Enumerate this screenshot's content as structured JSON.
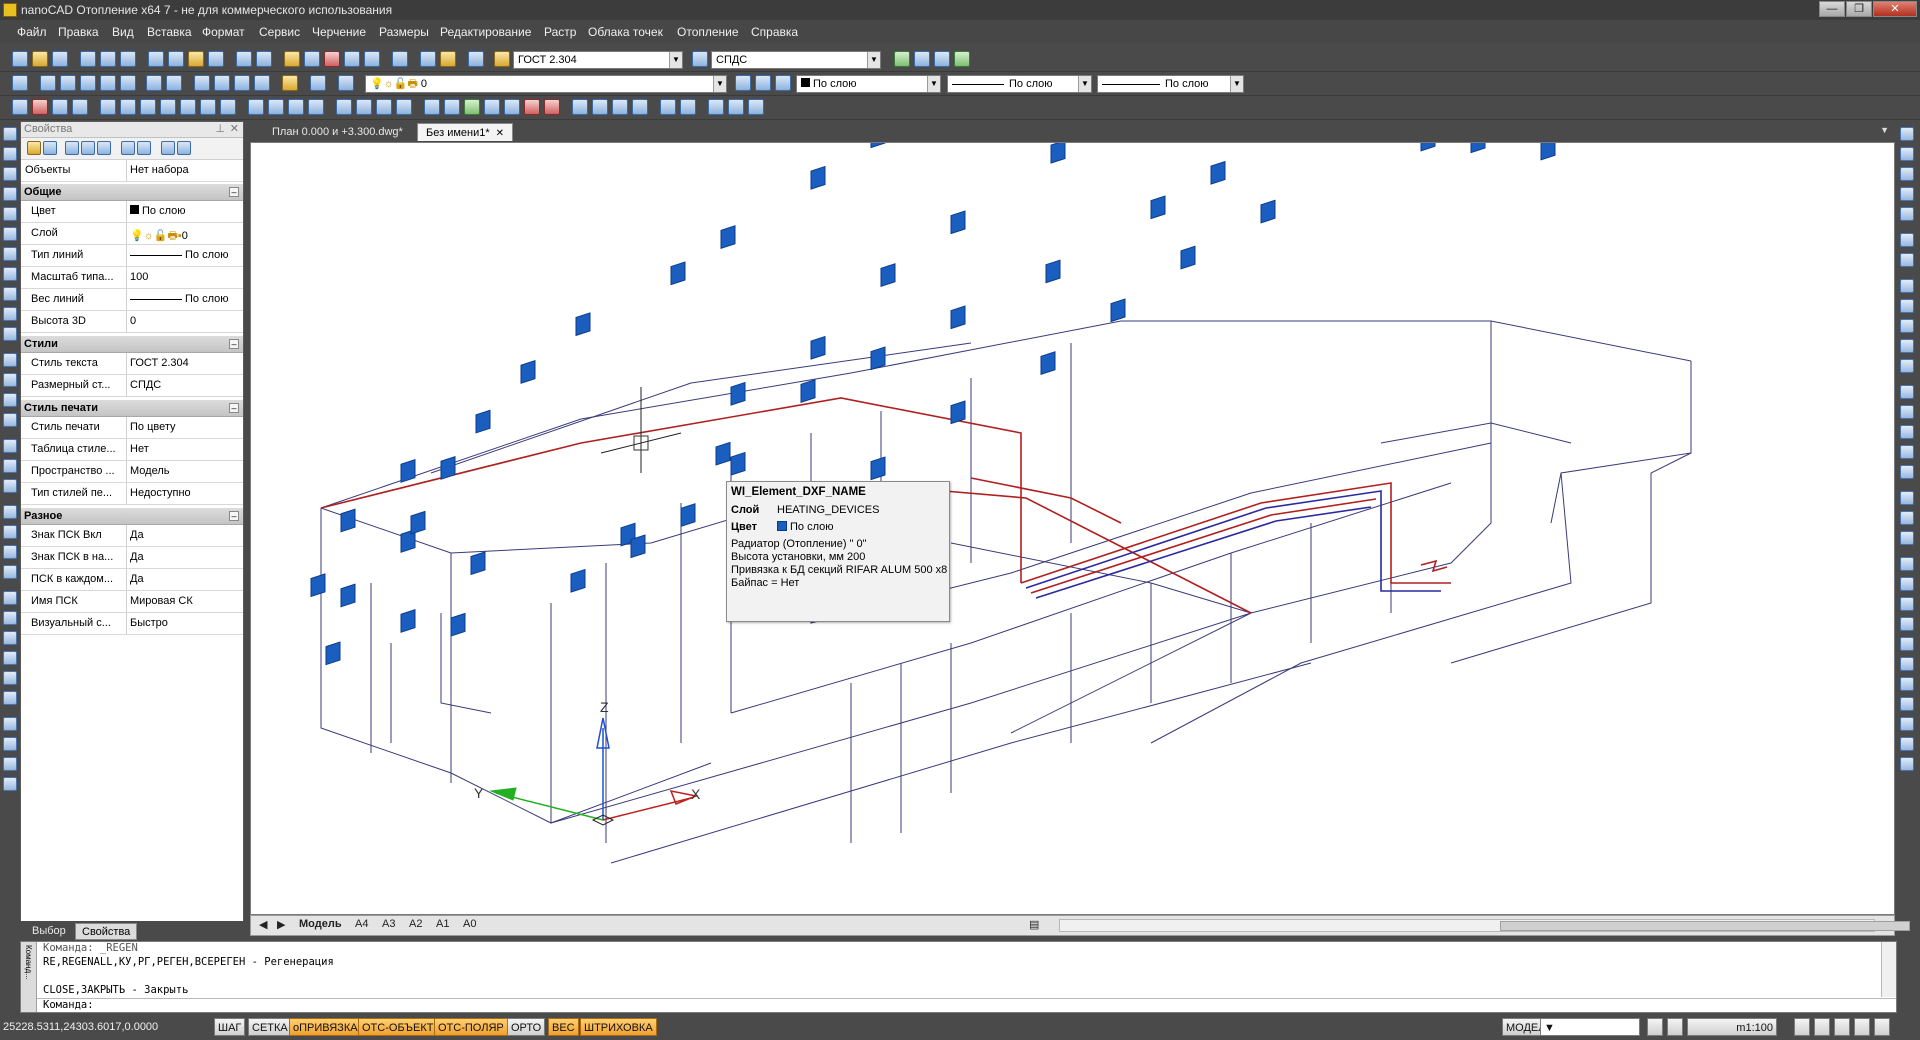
{
  "window": {
    "title": "nanoCAD Отопление x64 7 - не для коммерческого использования",
    "buttons": [
      "—",
      "❐",
      "✕"
    ]
  },
  "menu": [
    "Файл",
    "Правка",
    "Вид",
    "Вставка",
    "Формат",
    "Сервис",
    "Черчение",
    "Размеры",
    "Редактирование",
    "Растр",
    "Облака точек",
    "Отопление",
    "Справка"
  ],
  "toolbar": {
    "text_style": "ГОСТ 2.304",
    "dim_style": "СПДС",
    "layer": "0",
    "color": "По слою",
    "linetype": "По слою",
    "lineweight": "По слою"
  },
  "properties": {
    "title": "Свойства",
    "objects_key": "Объекты",
    "objects_value": "Нет набора",
    "sections": [
      {
        "name": "Общие",
        "rows": [
          {
            "k": "Цвет",
            "v": "По слою"
          },
          {
            "k": "Слой",
            "v": "0"
          },
          {
            "k": "Тип линий",
            "v": "По слою"
          },
          {
            "k": "Масштаб типа...",
            "v": "100"
          },
          {
            "k": "Вес линий",
            "v": "По слою"
          },
          {
            "k": "Высота 3D",
            "v": "0"
          }
        ]
      },
      {
        "name": "Стили",
        "rows": [
          {
            "k": "Стиль текста",
            "v": "ГОСТ 2.304"
          },
          {
            "k": "Размерный ст...",
            "v": "СПДС"
          }
        ]
      },
      {
        "name": "Стиль печати",
        "rows": [
          {
            "k": "Стиль печати",
            "v": "По цвету"
          },
          {
            "k": "Таблица стиле...",
            "v": "Нет"
          },
          {
            "k": "Пространство ...",
            "v": "Модель"
          },
          {
            "k": "Тип стилей пе...",
            "v": "Недоступно"
          }
        ]
      },
      {
        "name": "Разное",
        "rows": [
          {
            "k": "Знак ПСК Вкл",
            "v": "Да"
          },
          {
            "k": "Знак ПСК в на...",
            "v": "Да"
          },
          {
            "k": "ПСК в каждом...",
            "v": "Да"
          },
          {
            "k": "Имя ПСК",
            "v": "Мировая СК"
          },
          {
            "k": "Визуальный с...",
            "v": "Быстро"
          }
        ]
      }
    ],
    "tabs": [
      "Выбор",
      "Свойства"
    ]
  },
  "doc_tabs": [
    "План 0.000 и +3.300.dwg*",
    "Без имени1*"
  ],
  "tooltip": {
    "title": "WI_Element_DXF_NAME",
    "layer_key": "Слой",
    "layer_val": "HEATING_DEVICES",
    "color_key": "Цвет",
    "color_val": "По слою",
    "lines": [
      "Радиатор (Отопление) \" 0\"",
      "Высота установки, мм 200",
      "Привязка к БД секций RIFAR ALUM 500 x8",
      "Байпас = Нет"
    ]
  },
  "axes": {
    "x": "X",
    "y": "Y",
    "z": "Z"
  },
  "layout_tabs": [
    "Модель",
    "A4",
    "A3",
    "A2",
    "A1",
    "A0"
  ],
  "command": {
    "lines": [
      "Команда: _REGEN",
      "RE,REGENALL,КУ,РГ,РЕГЕН,ВСЕРЕГЕН - Регенерация",
      "",
      "CLOSE,ЗАКРЫТЬ - Закрыть"
    ],
    "prompt": "Команда:",
    "side_label": "Команд..."
  },
  "status": {
    "coords": "25228.5311,24303.6017,0.0000",
    "toggles": [
      {
        "label": "ШАГ",
        "on": false
      },
      {
        "label": "СЕТКА",
        "on": false
      },
      {
        "label": "оПРИВЯЗКА",
        "on": true
      },
      {
        "label": "ОТС-ОБЪЕКТ",
        "on": true
      },
      {
        "label": "ОТС-ПОЛЯР",
        "on": true
      },
      {
        "label": "ОРТО",
        "on": false
      },
      {
        "label": "ВЕС",
        "on": true
      },
      {
        "label": "ШТРИХОВКА",
        "on": true
      }
    ],
    "space": "МОДЕЛЬ",
    "scale": "m1:100"
  },
  "colors": {
    "wall_line": "#2a2a8a",
    "pipe_red": "#b02020",
    "radiator": "#1a5fc0",
    "radiator_dark": "#0b3a8a"
  }
}
